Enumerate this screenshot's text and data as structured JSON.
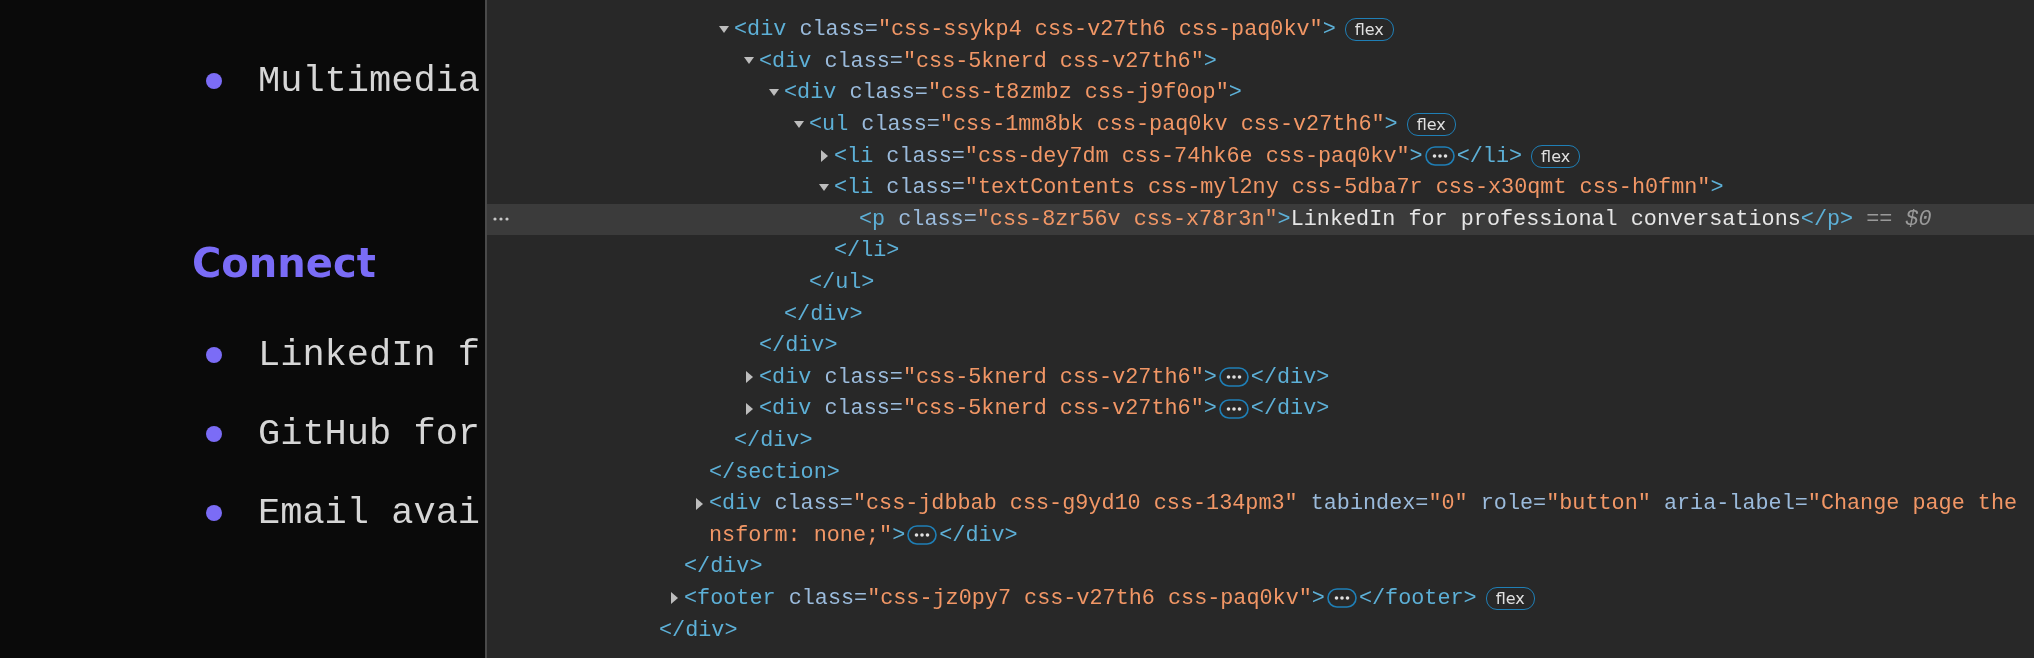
{
  "page": {
    "list_items": [
      {
        "text": "Multimedia"
      }
    ],
    "section": {
      "heading": "Connect",
      "items": [
        {
          "text": "LinkedIn f"
        },
        {
          "text": "GitHub for"
        },
        {
          "text": "Email avai"
        }
      ]
    }
  },
  "devtools": {
    "tree": [
      {
        "children": [
          {
            "children": [
              {
                "children": [
                  {
                    "line": [
                      {
                        "kind": "tag",
                        "text": "<div"
                      },
                      {
                        "kind": "attr",
                        "text": " class="
                      },
                      {
                        "kind": "value",
                        "text": "\"css-ssykp4 css-v27th6 css-paq0kv\""
                      },
                      {
                        "kind": "tag",
                        "text": ">"
                      },
                      {
                        "kind": "badge",
                        "text": "flex"
                      }
                    ],
                    "expanded": true,
                    "selected": false,
                    "children": [
                      {
                        "line": [
                          {
                            "kind": "tag",
                            "text": "<div"
                          },
                          {
                            "kind": "attr",
                            "text": " class="
                          },
                          {
                            "kind": "value",
                            "text": "\"css-5knerd css-v27th6\""
                          },
                          {
                            "kind": "tag",
                            "text": ">"
                          }
                        ],
                        "expanded": true,
                        "selected": false,
                        "children": [
                          {
                            "line": [
                              {
                                "kind": "tag",
                                "text": "<div"
                              },
                              {
                                "kind": "attr",
                                "text": " class="
                              },
                              {
                                "kind": "value",
                                "text": "\"css-t8zmbz css-j9f0op\""
                              },
                              {
                                "kind": "tag",
                                "text": ">"
                              }
                            ],
                            "expanded": true,
                            "selected": false,
                            "children": [
                              {
                                "line": [
                                  {
                                    "kind": "tag",
                                    "text": "<ul"
                                  },
                                  {
                                    "kind": "attr",
                                    "text": " class="
                                  },
                                  {
                                    "kind": "value",
                                    "text": "\"css-1mm8bk css-paq0kv css-v27th6\""
                                  },
                                  {
                                    "kind": "tag",
                                    "text": ">"
                                  },
                                  {
                                    "kind": "badge",
                                    "text": "flex"
                                  }
                                ],
                                "expanded": true,
                                "selected": false,
                                "children": [
                                  {
                                    "line": [
                                      {
                                        "kind": "tag",
                                        "text": "<li"
                                      },
                                      {
                                        "kind": "attr",
                                        "text": " class="
                                      },
                                      {
                                        "kind": "value",
                                        "text": "\"css-dey7dm css-74hk6e css-paq0kv\""
                                      },
                                      {
                                        "kind": "tag",
                                        "text": ">"
                                      },
                                      {
                                        "kind": "ellipsis"
                                      },
                                      {
                                        "kind": "tag",
                                        "text": "</li>"
                                      },
                                      {
                                        "kind": "badge",
                                        "text": "flex"
                                      }
                                    ],
                                    "expanded": false,
                                    "selected": false
                                  },
                                  {
                                    "line": [
                                      {
                                        "kind": "tag",
                                        "text": "<li"
                                      },
                                      {
                                        "kind": "attr",
                                        "text": " class="
                                      },
                                      {
                                        "kind": "value",
                                        "text": "\"textContents css-myl2ny css-5dba7r css-x30qmt css-h0fmn\""
                                      },
                                      {
                                        "kind": "tag",
                                        "text": ">"
                                      }
                                    ],
                                    "expanded": true,
                                    "selected": false,
                                    "children": [
                                      {
                                        "line": [
                                          {
                                            "kind": "tag",
                                            "text": "<p"
                                          },
                                          {
                                            "kind": "attr",
                                            "text": " class="
                                          },
                                          {
                                            "kind": "value",
                                            "text": "\"css-8zr56v css-x78r3n\""
                                          },
                                          {
                                            "kind": "tag",
                                            "text": ">"
                                          },
                                          {
                                            "kind": "text",
                                            "text": "LinkedIn for professional conversations"
                                          },
                                          {
                                            "kind": "tag",
                                            "text": "</p>"
                                          },
                                          {
                                            "kind": "eq",
                                            "text": "=="
                                          },
                                          {
                                            "kind": "var",
                                            "text": "$0"
                                          }
                                        ],
                                        "selected": true
                                      }
                                    ],
                                    "close": [
                                      {
                                        "kind": "tag",
                                        "text": "</li>"
                                      }
                                    ]
                                  }
                                ],
                                "close": [
                                  {
                                    "kind": "tag",
                                    "text": "</ul>"
                                  }
                                ]
                              }
                            ],
                            "close": [
                              {
                                "kind": "tag",
                                "text": "</div>"
                              }
                            ]
                          }
                        ],
                        "close": [
                          {
                            "kind": "tag",
                            "text": "</div>"
                          }
                        ]
                      },
                      {
                        "line": [
                          {
                            "kind": "tag",
                            "text": "<div"
                          },
                          {
                            "kind": "attr",
                            "text": " class="
                          },
                          {
                            "kind": "value",
                            "text": "\"css-5knerd css-v27th6\""
                          },
                          {
                            "kind": "tag",
                            "text": ">"
                          },
                          {
                            "kind": "ellipsis"
                          },
                          {
                            "kind": "tag",
                            "text": "</div>"
                          }
                        ],
                        "expanded": false,
                        "selected": false
                      },
                      {
                        "line": [
                          {
                            "kind": "tag",
                            "text": "<div"
                          },
                          {
                            "kind": "attr",
                            "text": " class="
                          },
                          {
                            "kind": "value",
                            "text": "\"css-5knerd css-v27th6\""
                          },
                          {
                            "kind": "tag",
                            "text": ">"
                          },
                          {
                            "kind": "ellipsis"
                          },
                          {
                            "kind": "tag",
                            "text": "</div>"
                          }
                        ],
                        "expanded": false,
                        "selected": false
                      }
                    ],
                    "close": [
                      {
                        "kind": "tag",
                        "text": "</div>"
                      }
                    ]
                  }
                ],
                "close": [
                  {
                    "kind": "tag",
                    "text": "</section>"
                  }
                ]
              },
              {
                "line": [
                  {
                    "kind": "tag",
                    "text": "<div"
                  },
                  {
                    "kind": "attr",
                    "text": " class="
                  },
                  {
                    "kind": "value",
                    "text": "\"css-jdbbab css-g9yd10 css-134pm3\""
                  },
                  {
                    "kind": "attr",
                    "text": " tabindex="
                  },
                  {
                    "kind": "value",
                    "text": "\"0\""
                  },
                  {
                    "kind": "attr",
                    "text": " role="
                  },
                  {
                    "kind": "value",
                    "text": "\"button\""
                  },
                  {
                    "kind": "attr",
                    "text": " aria-label="
                  },
                  {
                    "kind": "value",
                    "text": "\"Change page the"
                  },
                  {
                    "kind": "break"
                  },
                  {
                    "kind": "value",
                    "text": "nsform: none;\""
                  },
                  {
                    "kind": "tag",
                    "text": ">"
                  },
                  {
                    "kind": "ellipsis"
                  },
                  {
                    "kind": "tag",
                    "text": "</div>"
                  }
                ],
                "expanded": false,
                "selected": false
              }
            ],
            "close": [
              {
                "kind": "tag",
                "text": "</div>"
              }
            ]
          },
          {
            "line": [
              {
                "kind": "tag",
                "text": "<footer"
              },
              {
                "kind": "attr",
                "text": " class="
              },
              {
                "kind": "value",
                "text": "\"css-jz0py7 css-v27th6 css-paq0kv\""
              },
              {
                "kind": "tag",
                "text": ">"
              },
              {
                "kind": "ellipsis"
              },
              {
                "kind": "tag",
                "text": "</footer>"
              },
              {
                "kind": "badge",
                "text": "flex"
              }
            ],
            "expanded": false,
            "selected": false
          }
        ],
        "close": [
          {
            "kind": "tag",
            "text": "</div>"
          }
        ]
      }
    ]
  }
}
